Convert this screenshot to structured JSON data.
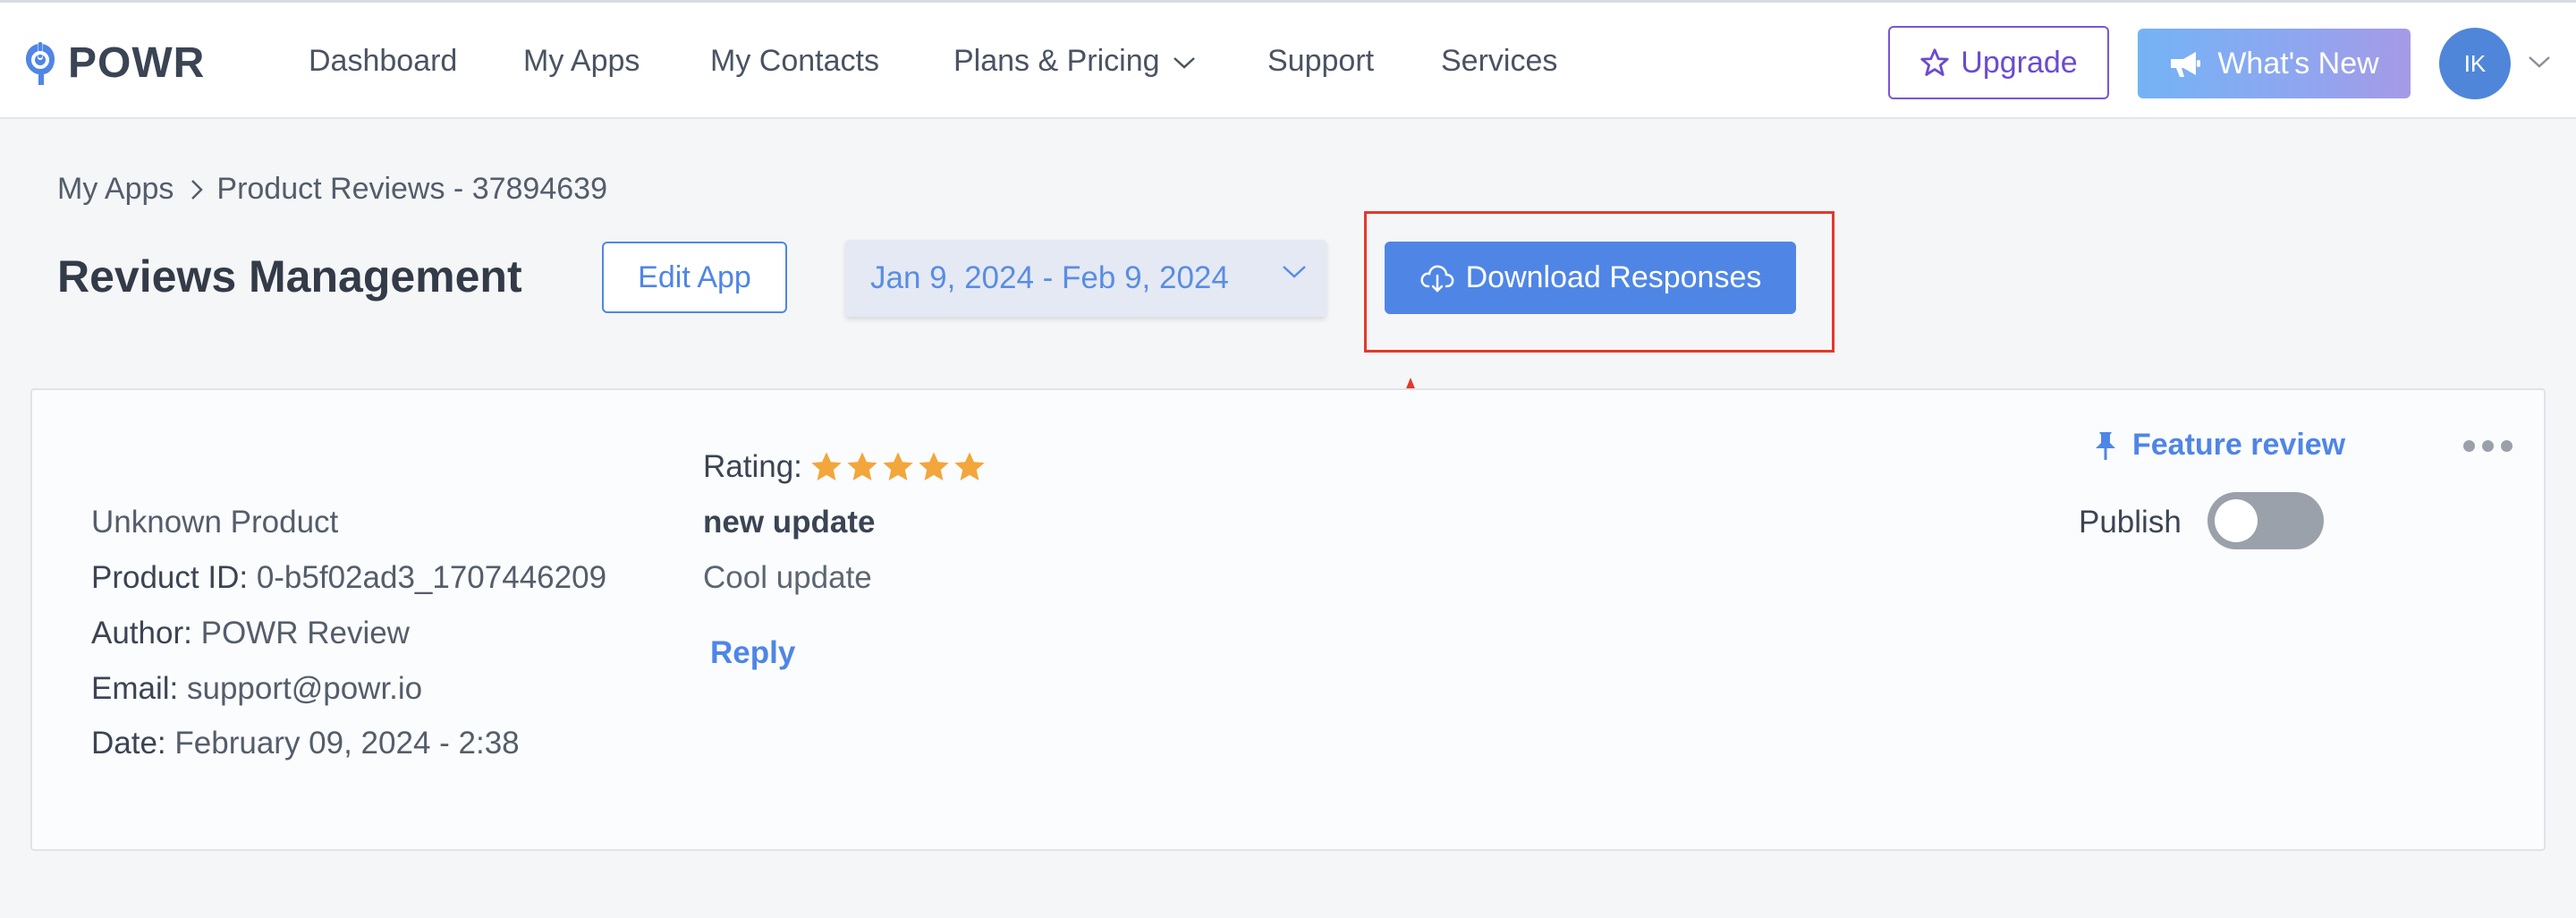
{
  "brand": {
    "name": "POWR",
    "icon": "powr-logo-icon"
  },
  "nav": {
    "items": [
      {
        "label": "Dashboard"
      },
      {
        "label": "My Apps"
      },
      {
        "label": "My Contacts"
      },
      {
        "label": "Plans & Pricing",
        "has_dropdown": true
      },
      {
        "label": "Support"
      },
      {
        "label": "Services"
      }
    ],
    "upgrade_label": "Upgrade",
    "whats_new_label": "What's New",
    "avatar_initials": "IK"
  },
  "breadcrumb": {
    "root": "My Apps",
    "current": "Product Reviews - 37894639"
  },
  "header": {
    "title": "Reviews Management",
    "edit_label": "Edit App",
    "date_range": "Jan 9, 2024 - Feb 9, 2024",
    "download_label": "Download Responses"
  },
  "review": {
    "product": "Unknown Product",
    "product_id_label": "Product ID:",
    "product_id": "0-b5f02ad3_1707446209",
    "author_label": "Author:",
    "author": "POWR Review",
    "email_label": "Email:",
    "email": "support@powr.io",
    "date_label": "Date:",
    "date": "February 09, 2024 - 2:38",
    "rating_label": "Rating:",
    "rating": 5,
    "rating_max": 5,
    "title": "new update",
    "body": "Cool update",
    "reply_label": "Reply",
    "feature_label": "Feature review",
    "publish_label": "Publish",
    "published": false
  },
  "colors": {
    "accent": "#4f86e6",
    "upgrade": "#6b4bd1",
    "star": "#f3a63b",
    "annotation": "#e3382b"
  }
}
